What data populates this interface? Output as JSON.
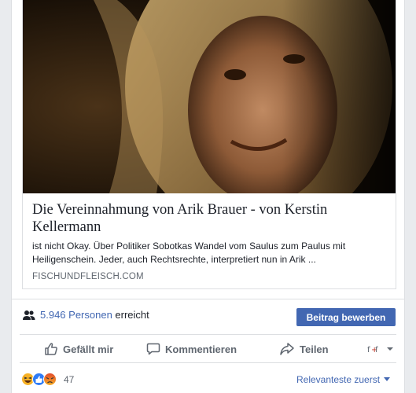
{
  "link_preview": {
    "title": "Die Vereinnahmung von Arik Brauer - von Kerstin Kellermann",
    "description": "ist nicht Okay. Über Politiker Sobotkas Wandel vom Saulus zum Paulus mit Heiligenschein. Jeder, auch Rechtsrechte, interpretiert nun in Arik ...",
    "domain": "FISCHUNDFLEISCH.COM"
  },
  "reach": {
    "count_link": "5.946 Personen",
    "suffix": "erreicht",
    "boost_button": "Beitrag bewerben",
    "icon": "people-icon"
  },
  "actions": {
    "like": "Gefällt mir",
    "comment": "Kommentieren",
    "share": "Teilen"
  },
  "reactions": {
    "count": "47",
    "types": [
      "haha",
      "like",
      "angry"
    ],
    "sort_label": "Relevanteste zuerst"
  },
  "colors": {
    "accent": "#4267b2",
    "muted": "#606770",
    "border": "#dddfe2",
    "page_bg": "#e9ebee"
  }
}
